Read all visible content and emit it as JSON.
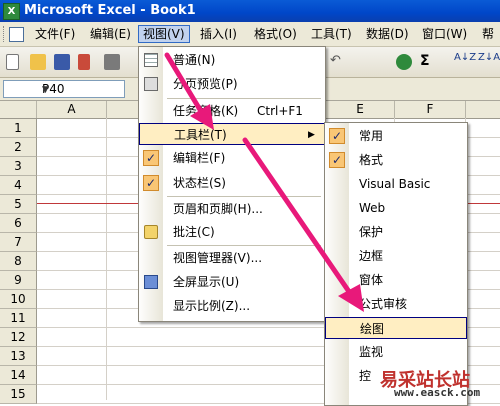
{
  "window": {
    "title": "Microsoft Excel - Book1",
    "app_icon": "X"
  },
  "menubar": {
    "items": [
      {
        "label": "文件(F)"
      },
      {
        "label": "编辑(E)"
      },
      {
        "label": "视图(V)"
      },
      {
        "label": "插入(I)"
      },
      {
        "label": "格式(O)"
      },
      {
        "label": "工具(T)"
      },
      {
        "label": "数据(D)"
      },
      {
        "label": "窗口(W)"
      },
      {
        "label": "帮"
      }
    ]
  },
  "namebox": {
    "value": "P40"
  },
  "columns": [
    "A",
    "E",
    "F"
  ],
  "rows": [
    "1",
    "2",
    "3",
    "4",
    "5",
    "6",
    "7",
    "8",
    "9",
    "10",
    "11",
    "12",
    "13",
    "14",
    "15"
  ],
  "view_menu": {
    "items": [
      {
        "label": "普通(N)"
      },
      {
        "label": "分页预览(P)"
      },
      {
        "label": "任务窗格(K)",
        "shortcut": "Ctrl+F1"
      },
      {
        "label": "工具栏(T)"
      },
      {
        "label": "编辑栏(F)"
      },
      {
        "label": "状态栏(S)"
      },
      {
        "label": "页眉和页脚(H)..."
      },
      {
        "label": "批注(C)"
      },
      {
        "label": "视图管理器(V)..."
      },
      {
        "label": "全屏显示(U)"
      },
      {
        "label": "显示比例(Z)..."
      }
    ]
  },
  "toolbar_submenu": {
    "items": [
      {
        "label": "常用",
        "checked": true
      },
      {
        "label": "格式",
        "checked": true
      },
      {
        "label": "Visual Basic"
      },
      {
        "label": "Web"
      },
      {
        "label": "保护"
      },
      {
        "label": "边框"
      },
      {
        "label": "窗体"
      },
      {
        "label": "公式审核"
      },
      {
        "label": "绘图"
      },
      {
        "label": "监视"
      },
      {
        "label": "控"
      }
    ]
  },
  "watermark": {
    "text": "易采站长站",
    "url": "www.easck.com"
  },
  "colors": {
    "highlight": "#ffeec2",
    "arrow": "#e8197a",
    "check": "#f9c675",
    "titlebar": "#0a5bd6"
  }
}
